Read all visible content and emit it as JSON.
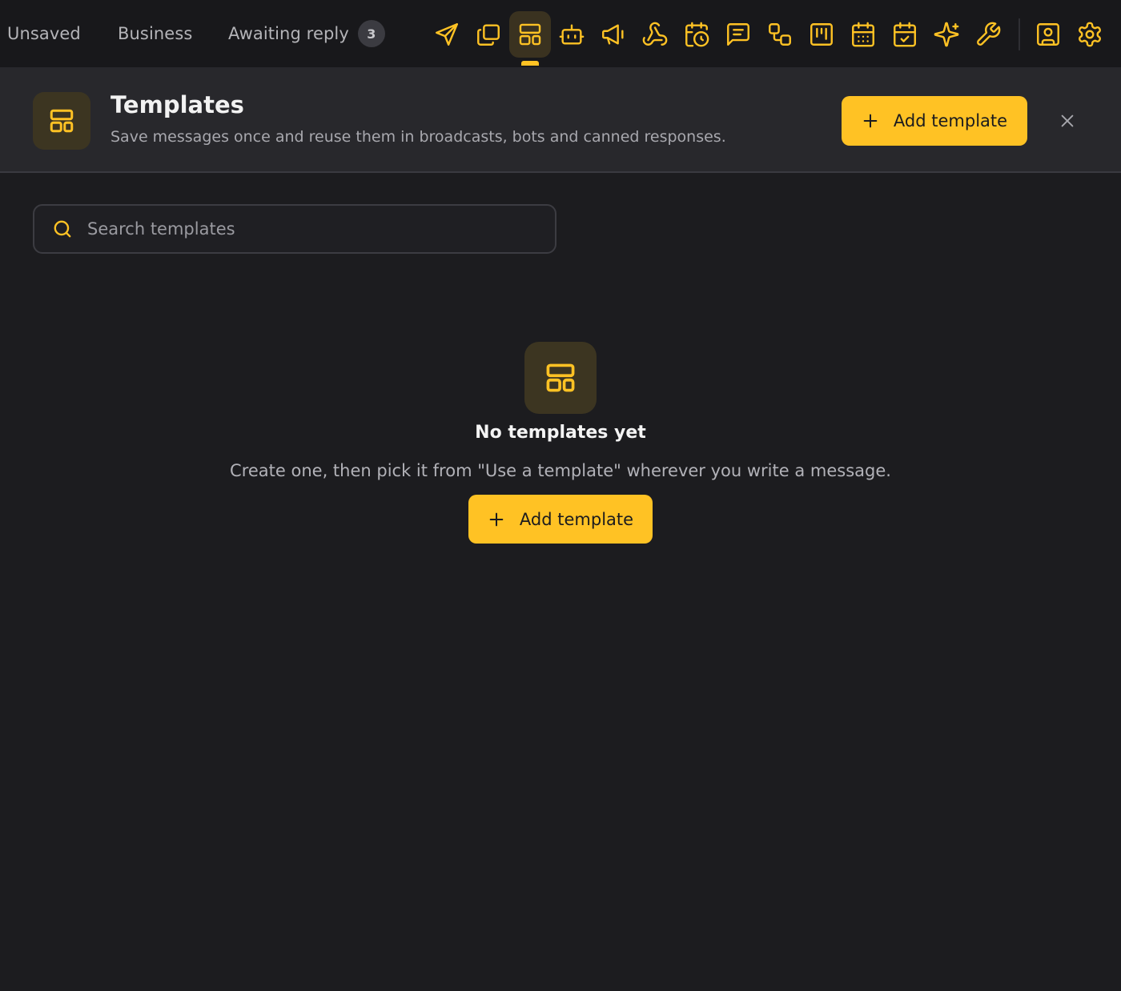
{
  "topbar": {
    "filters": [
      {
        "label": "Unsaved"
      },
      {
        "label": "Business"
      },
      {
        "label": "Awaiting reply",
        "count": "3"
      }
    ],
    "tools": [
      {
        "icon": "send-icon",
        "active": false
      },
      {
        "icon": "copy-icon",
        "active": false
      },
      {
        "icon": "templates-icon",
        "active": true
      },
      {
        "icon": "bot-icon",
        "active": false
      },
      {
        "icon": "megaphone-icon",
        "active": false
      },
      {
        "icon": "webhook-icon",
        "active": false
      },
      {
        "icon": "calendar-clock-icon",
        "active": false
      },
      {
        "icon": "message-text-icon",
        "active": false
      },
      {
        "icon": "workflow-icon",
        "active": false
      },
      {
        "icon": "kanban-icon",
        "active": false
      },
      {
        "icon": "calendar-grid-icon",
        "active": false
      },
      {
        "icon": "calendar-check-icon",
        "active": false
      },
      {
        "icon": "sparkles-icon",
        "active": false
      },
      {
        "icon": "wrench-icon",
        "active": false
      },
      {
        "icon": "contact-card-icon",
        "active": false
      },
      {
        "icon": "settings-icon",
        "active": false
      }
    ]
  },
  "header": {
    "icon": "templates-icon",
    "title": "Templates",
    "subtitle": "Save messages once and reuse them in broadcasts, bots and canned responses.",
    "add_button_label": "Add template",
    "close_icon": "close-icon"
  },
  "search": {
    "placeholder": "Search templates",
    "value": "",
    "icon": "search-icon"
  },
  "empty_state": {
    "icon": "templates-icon",
    "title": "No templates yet",
    "description": "Create one, then pick it from \"Use a template\" wherever you write a message.",
    "add_button_label": "Add template"
  },
  "colors": {
    "accent": "#ffc224",
    "background": "#1c1c1f",
    "topbar": "#18181b",
    "header_panel": "#28282c",
    "icon_tile": "#3c3521"
  }
}
